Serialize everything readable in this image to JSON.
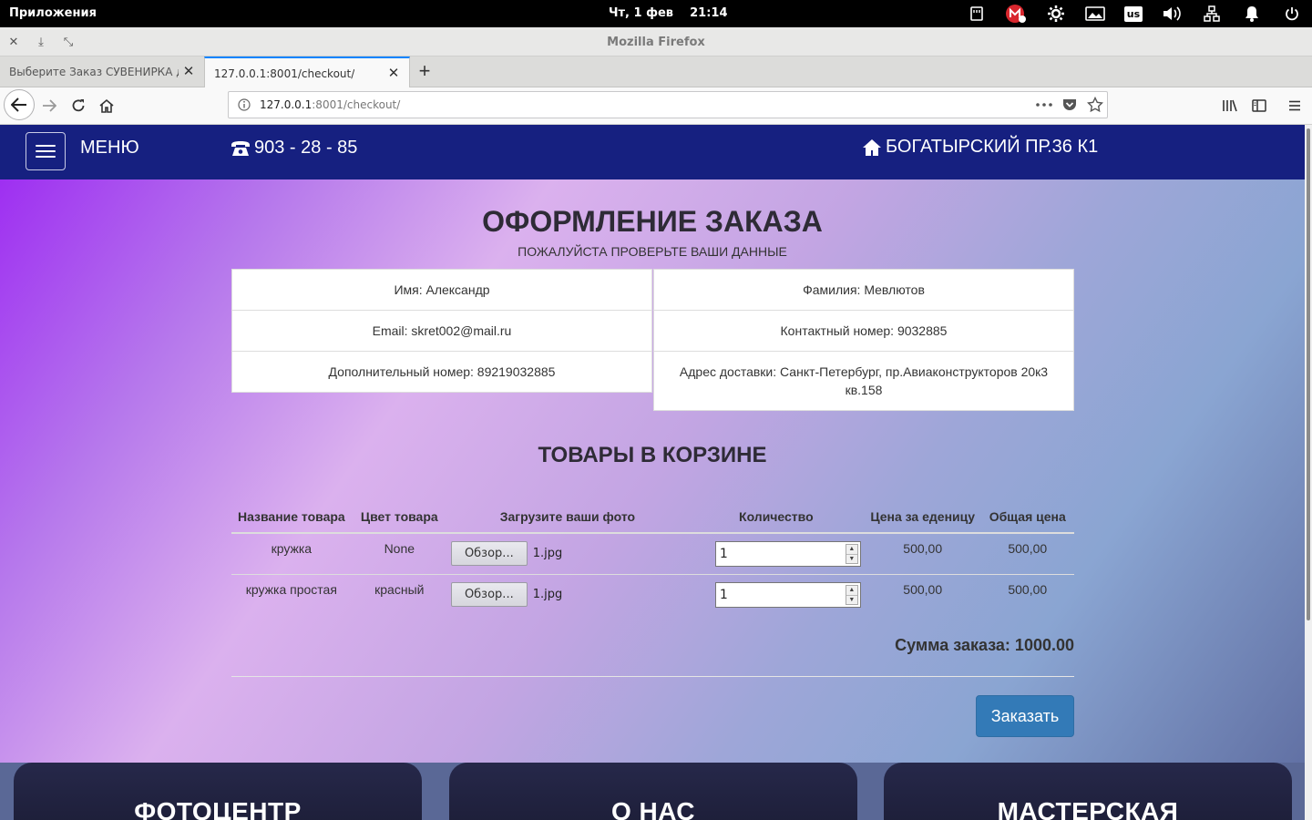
{
  "system": {
    "apps_label": "Приложения",
    "clock": "Чт, 1 фев    21:14",
    "keyboard_layout": "us"
  },
  "window": {
    "title": "Mozilla Firefox"
  },
  "tabs": [
    {
      "label": "Выберите Заказ СУВЕНИРКА для"
    },
    {
      "label": "127.0.0.1:8001/checkout/"
    }
  ],
  "urlbar": {
    "host": "127.0.0.1",
    "path": ":8001/checkout/"
  },
  "site": {
    "menu_label": "МЕНЮ",
    "phone": "903 - 28 - 85",
    "address": "БОГАТЫРСКИЙ ПР.36 К1"
  },
  "checkout": {
    "title": "ОФОРМЛЕНИЕ ЗАКАЗА",
    "subtitle": "ПОЖАЛУЙСТА ПРОВЕРЬТЕ ВАШИ ДАННЫЕ",
    "left": {
      "name": "Имя: Александр",
      "email": "Email: skret002@mail.ru",
      "extra_phone": "Дополнительный номер: 89219032885"
    },
    "right": {
      "surname": "Фамилия: Мевлютов",
      "contact_phone": "Контактный номер: 9032885",
      "delivery": "Адрес доставки: Санкт-Петербург, пр.Авиаконструкторов 20к3 кв.158"
    }
  },
  "cart": {
    "title": "ТОВАРЫ В КОРЗИНЕ",
    "headers": {
      "name": "Название товара",
      "color": "Цвет товара",
      "photo": "Загрузите ваши фото",
      "qty": "Количество",
      "unit_price": "Цена за еденицу",
      "total_price": "Общая цена"
    },
    "rows": [
      {
        "name": "кружка",
        "color": "None",
        "browse": "Обзор...",
        "file": "1.jpg",
        "qty": "1",
        "unit_price": "500,00",
        "total_price": "500,00"
      },
      {
        "name": "кружка простая",
        "color": "красный",
        "browse": "Обзор...",
        "file": "1.jpg",
        "qty": "1",
        "unit_price": "500,00",
        "total_price": "500,00"
      }
    ],
    "sum": "Сумма заказа: 1000.00",
    "order_button": "Заказать"
  },
  "footer_cards": [
    "ФОТОЦЕНТР",
    "О НАС",
    "МАСТЕРСКАЯ"
  ],
  "colors": {
    "site_nav": "#162080",
    "order_button": "#337ab7",
    "tab_accent": "#0a84ff"
  }
}
